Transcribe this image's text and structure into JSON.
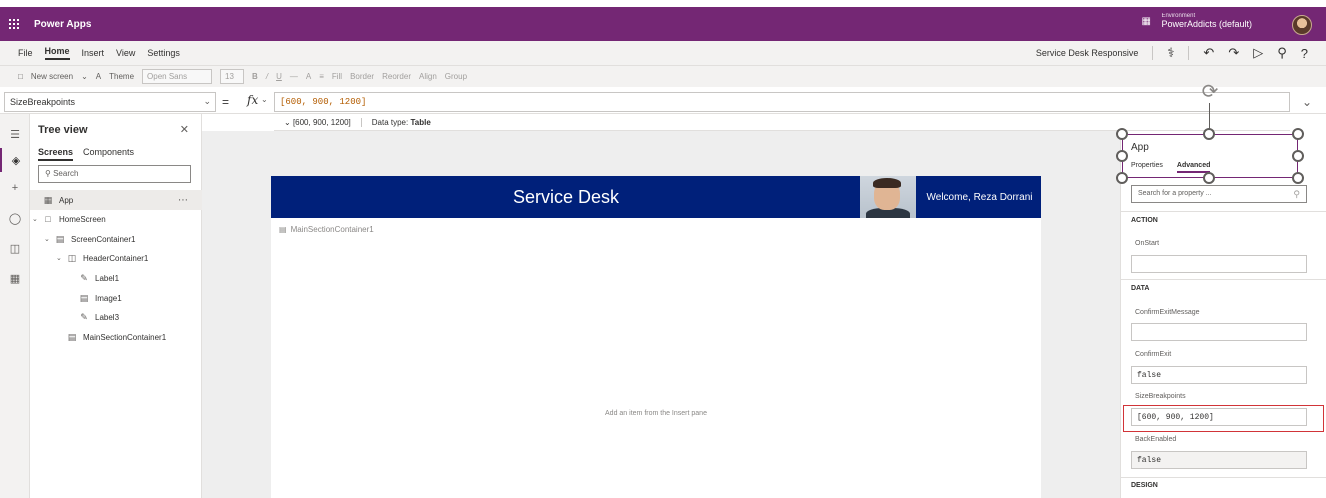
{
  "titlebar": {
    "app_name": "Power Apps",
    "environment_label": "Environment",
    "environment_name": "PowerAddicts (default)"
  },
  "menu": {
    "items": [
      "File",
      "Home",
      "Insert",
      "View",
      "Settings"
    ],
    "active": "Home",
    "app_title": "Service Desk Responsive"
  },
  "ribbon": {
    "new_screen": "New screen",
    "theme": "Theme",
    "font": "Open Sans",
    "font_size": "13",
    "fill": "Fill",
    "border": "Border",
    "reorder": "Reorder",
    "align": "Align",
    "group": "Group"
  },
  "formula": {
    "property": "SizeBreakpoints",
    "equals": "=",
    "fx": "fx",
    "value": "[600, 900, 1200]",
    "hint_result": "[600, 900, 1200]",
    "hint_type_label": "Data type:",
    "hint_type_value": "Table"
  },
  "treeview": {
    "title": "Tree view",
    "tabs": [
      "Screens",
      "Components"
    ],
    "search_placeholder": "Search",
    "items": [
      {
        "label": "App"
      },
      {
        "label": "HomeScreen"
      },
      {
        "label": "ScreenContainer1"
      },
      {
        "label": "HeaderContainer1"
      },
      {
        "label": "Label1"
      },
      {
        "label": "Image1"
      },
      {
        "label": "Label3"
      },
      {
        "label": "MainSectionContainer1"
      }
    ]
  },
  "canvas": {
    "header_title": "Service Desk",
    "welcome": "Welcome, Reza Dorrani",
    "main_section": "MainSectionContainer1",
    "add_hint": "Add an item from the Insert pane"
  },
  "properties": {
    "title": "App",
    "tabs": [
      "Properties",
      "Advanced"
    ],
    "active_tab": "Advanced",
    "search_placeholder": "Search for a property ...",
    "sections": {
      "action": "ACTION",
      "data": "DATA",
      "design": "DESIGN"
    },
    "fields": {
      "onstart_label": "OnStart",
      "onstart_value": "",
      "confirmexitmessage_label": "ConfirmExitMessage",
      "confirmexitmessage_value": "",
      "confirmexit_label": "ConfirmExit",
      "confirmexit_value": "false",
      "sizebreakpoints_label": "SizeBreakpoints",
      "sizebreakpoints_value": "[600, 900, 1200]",
      "backenabled_label": "BackEnabled",
      "backenabled_value": "false"
    }
  },
  "colors": {
    "brand": "#742774",
    "screen_header": "#00207a",
    "highlight": "#d13438"
  }
}
